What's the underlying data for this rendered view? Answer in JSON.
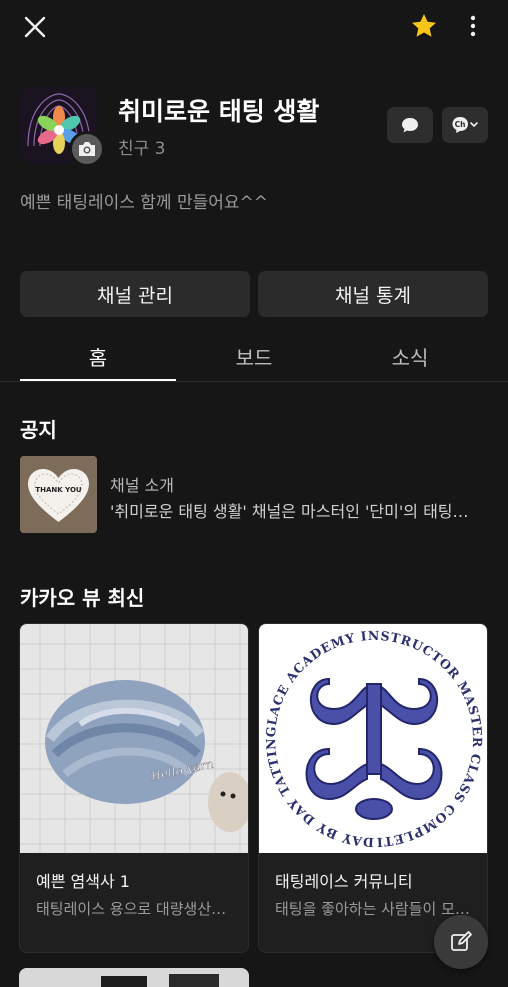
{
  "header": {
    "close_icon": "close-icon",
    "favorite_icon": "star-icon",
    "favorite_color": "#f5c518",
    "more_icon": "more-vertical-icon"
  },
  "channel": {
    "name": "취미로운 태팅 생활",
    "friends": "친구 3",
    "description": "예쁜 태팅레이스 함께 만들어요^^",
    "camera_icon": "camera-icon",
    "chat_icon": "chat-bubble-icon",
    "channel_icon": "channel-ch-icon",
    "ch_label": "Ch"
  },
  "actions": {
    "manage": "채널 관리",
    "stats": "채널 통계"
  },
  "tabs": [
    {
      "label": "홈",
      "active": true
    },
    {
      "label": "보드",
      "active": false
    },
    {
      "label": "소식",
      "active": false
    }
  ],
  "notice": {
    "section_title": "공지",
    "label": "채널 소개",
    "text": "'취미로운 태팅 생활' 채널은 마스터인 '단미'의 태팅레이스 채널입니다",
    "thumb_text": "THANK YOU"
  },
  "kakao_view": {
    "section_title": "카카오 뷰 최신",
    "cards": [
      {
        "title": "예쁜 염색사 1",
        "subtitle": "태팅레이스 용으로 대량생산된 실",
        "image_caption": "Hello-yarn"
      },
      {
        "title": "태팅레이스 커뮤니티",
        "subtitle": "태팅을 좋아하는 사람들이 모인 곳",
        "image_caption": "DAY BY DAY TATTINGLACE ACADEMY INSTRUCTOR MASTER CLASS COMPLETION."
      }
    ]
  },
  "fab": {
    "icon": "edit-icon"
  },
  "colors": {
    "background": "#161616",
    "button": "#2b2b2b",
    "accent_star": "#f5c518"
  }
}
